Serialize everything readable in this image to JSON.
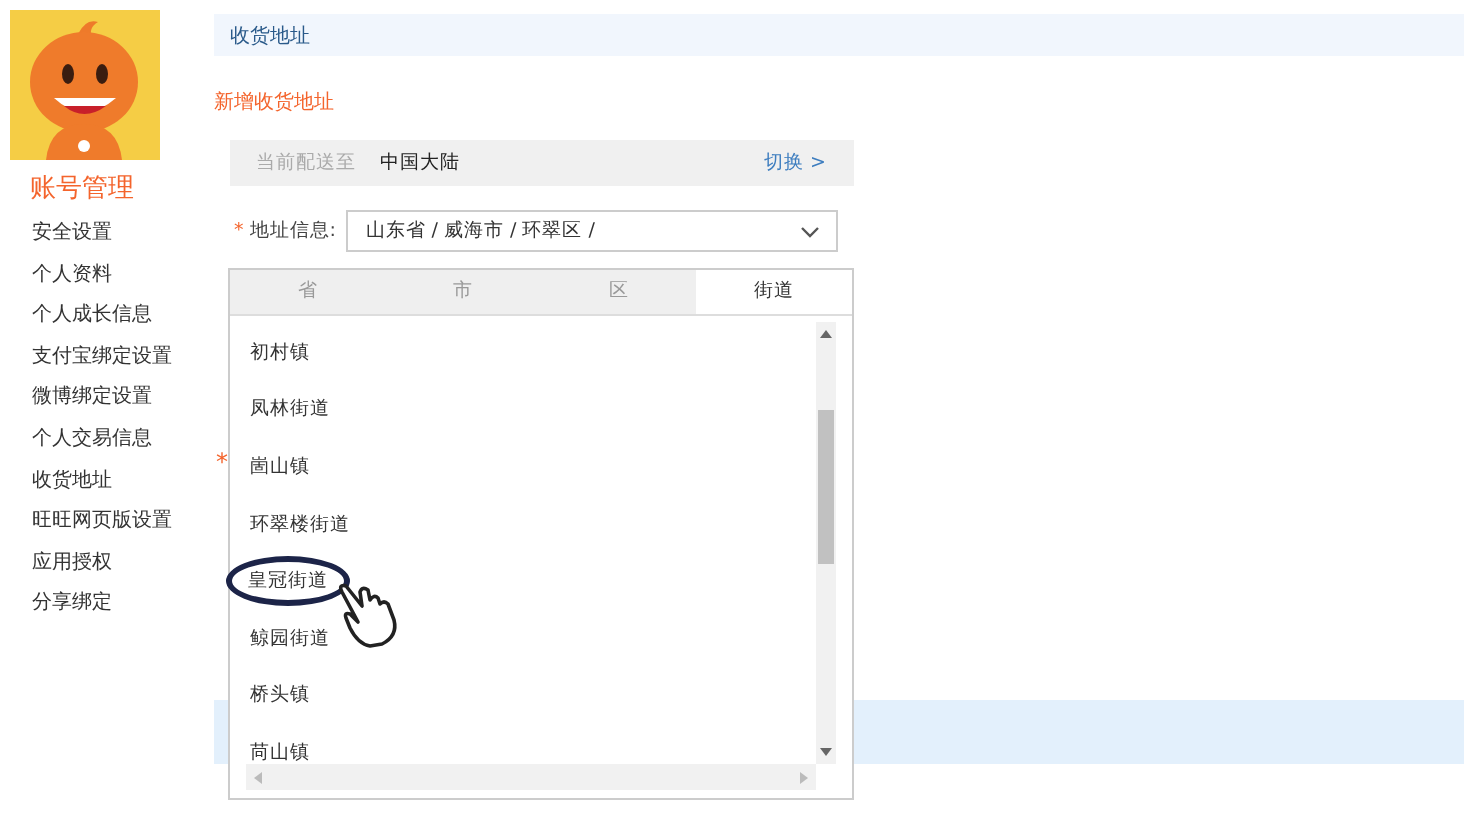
{
  "sidebar": {
    "title": "账号管理",
    "items": [
      {
        "label": "安全设置",
        "selected": false
      },
      {
        "label": "个人资料",
        "selected": false
      },
      {
        "label": "个人成长信息",
        "selected": false
      },
      {
        "label": "支付宝绑定设置",
        "selected": false
      },
      {
        "label": "微博绑定设置",
        "selected": false
      },
      {
        "label": "个人交易信息",
        "selected": false
      },
      {
        "label": "收货地址",
        "selected": false
      },
      {
        "label": "旺旺网页版设置",
        "selected": false
      },
      {
        "label": "应用授权",
        "selected": false
      },
      {
        "label": "分享绑定",
        "selected": false
      }
    ]
  },
  "header": {
    "title": "收货地址"
  },
  "add_link": "新增收货地址",
  "delivery": {
    "label": "当前配送至",
    "region": "中国大陆",
    "switch": "切换 >"
  },
  "address": {
    "required_mark": "*",
    "label": "地址信息:",
    "value": "山东省 / 威海市 / 环翠区 /"
  },
  "hidden_required_mark": "*",
  "dropdown": {
    "tabs": [
      {
        "label": "省",
        "selected": false
      },
      {
        "label": "市",
        "selected": false
      },
      {
        "label": "区",
        "selected": false
      },
      {
        "label": "街道",
        "selected": true
      }
    ],
    "options": [
      {
        "label": "初村镇",
        "circled": false
      },
      {
        "label": "凤林街道",
        "circled": false
      },
      {
        "label": "崮山镇",
        "circled": false
      },
      {
        "label": "环翠楼街道",
        "circled": false
      },
      {
        "label": "皇冠街道",
        "circled": true
      },
      {
        "label": "鲸园街道",
        "circled": false
      },
      {
        "label": "桥头镇",
        "circled": false
      },
      {
        "label": "苘山镇",
        "circled": false
      }
    ]
  }
}
